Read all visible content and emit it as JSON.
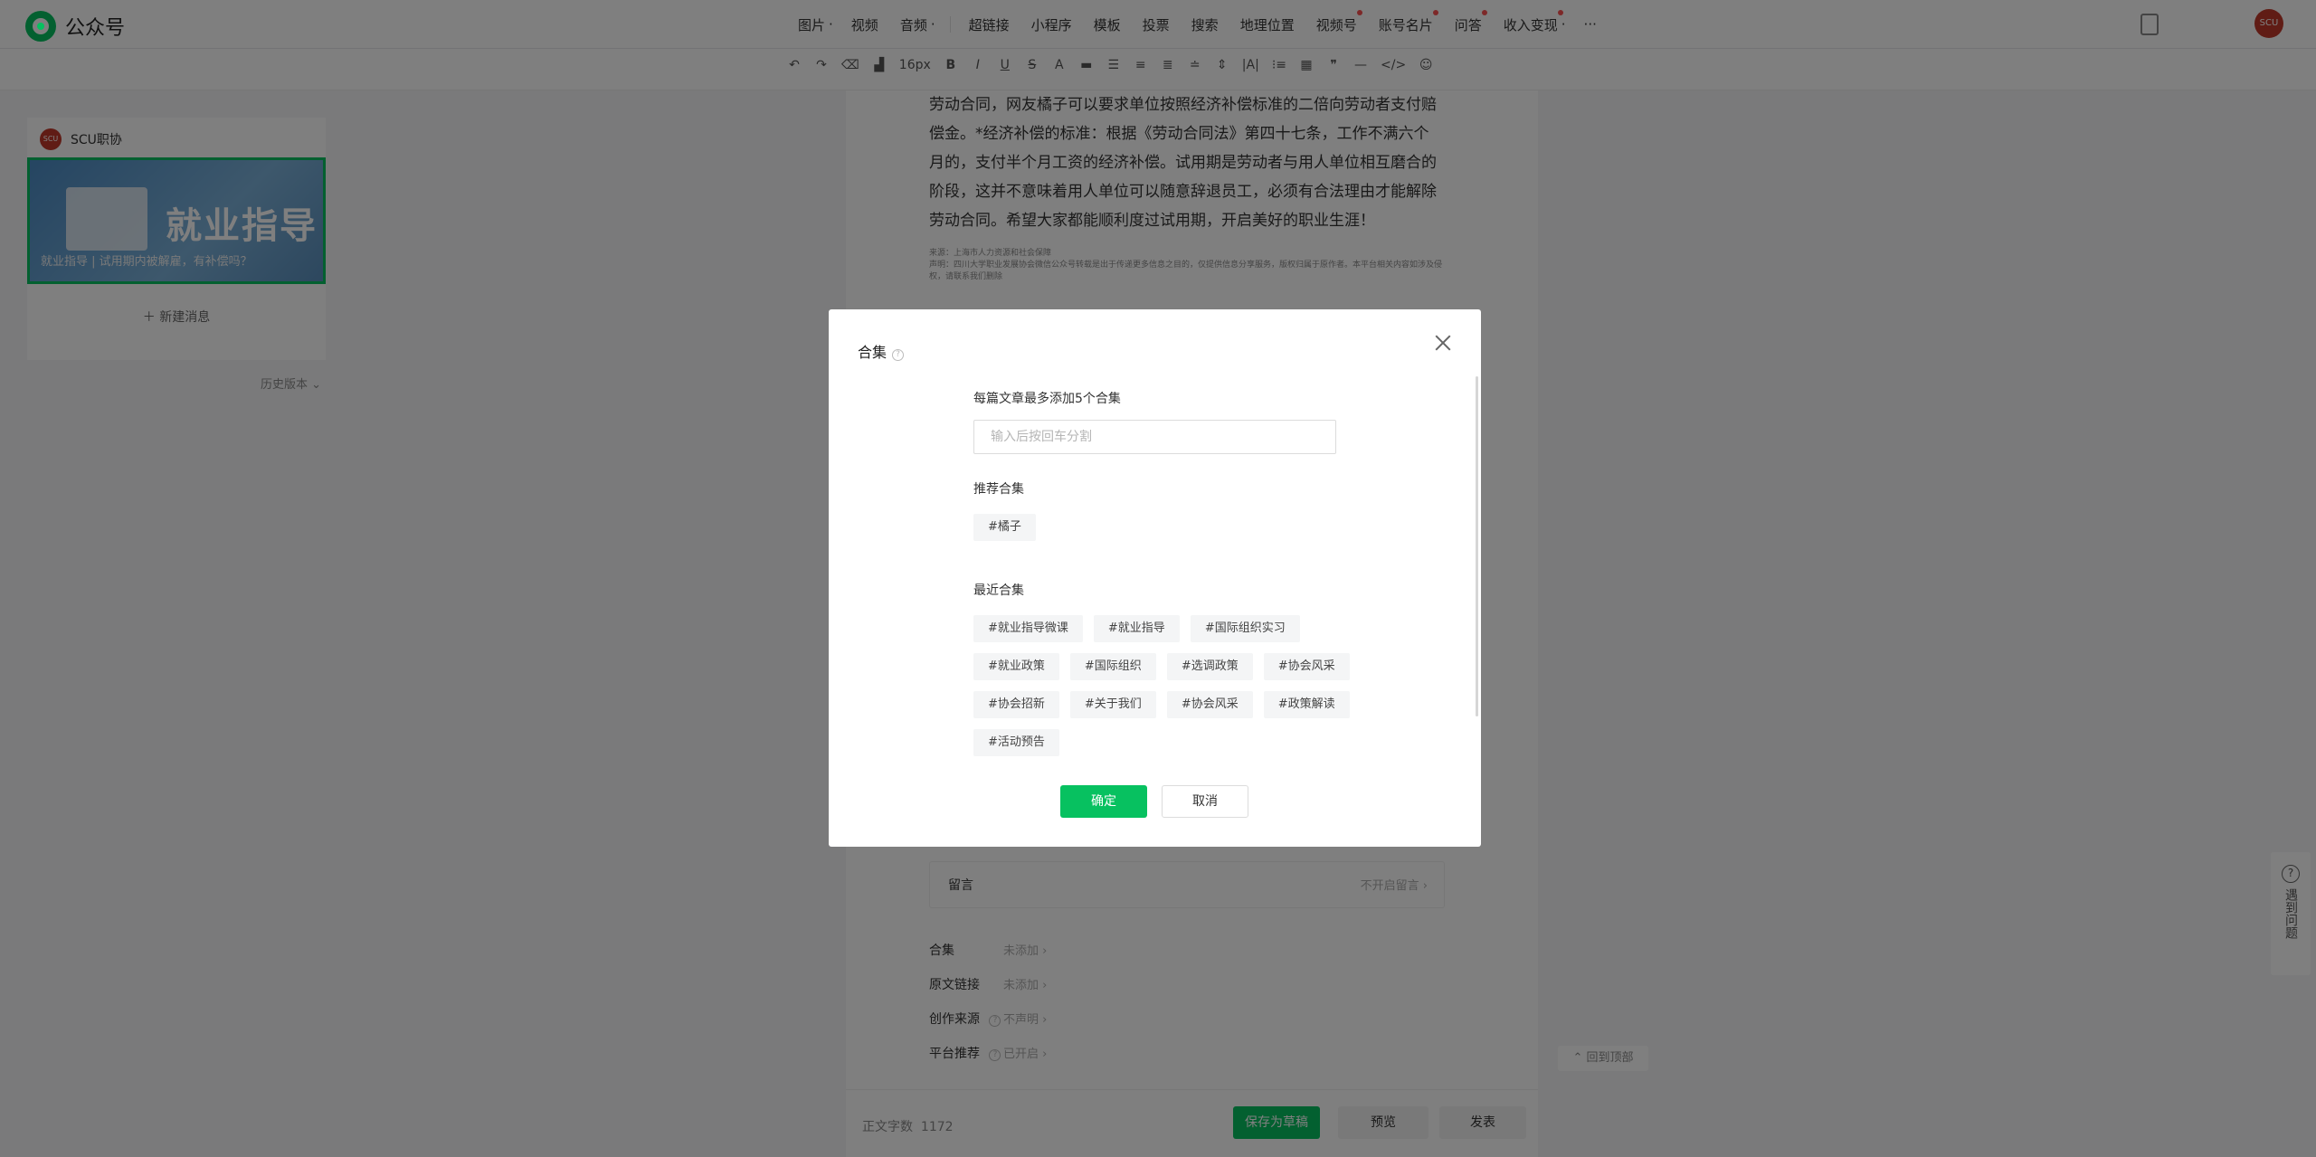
{
  "app": {
    "name": "公众号",
    "account": "SCU职协",
    "avatar_text": "SCU"
  },
  "nav": {
    "items": [
      {
        "label": "图片",
        "dropdown": true
      },
      {
        "label": "视频"
      },
      {
        "label": "音频",
        "dropdown": true
      },
      {
        "label": "超链接"
      },
      {
        "label": "小程序"
      },
      {
        "label": "模板"
      },
      {
        "label": "投票"
      },
      {
        "label": "搜索"
      },
      {
        "label": "地理位置"
      },
      {
        "label": "视频号",
        "dot": true
      },
      {
        "label": "账号名片",
        "dot": true
      },
      {
        "label": "问答",
        "dot": true
      },
      {
        "label": "收入变现",
        "dropdown": true,
        "dot": true
      },
      {
        "label": "···"
      }
    ]
  },
  "toolbar": {
    "font_size": "16px"
  },
  "left": {
    "cover_title": "就业指导",
    "cover_caption": "就业指导 | 试用期内被解雇，有补偿吗？",
    "new_message": "＋ 新建消息",
    "history": "历史版本"
  },
  "editor": {
    "paragraphs": [
      "劳动合同，网友橘子可以要求单位按照经济补偿标准的二倍向劳动者支付赔偿金。*经济补偿的标准：根据《劳动合同法》第四十七条，工作不满六个月的，支付半个月工资的经济补偿。试用期是劳动者与用人单位相互磨合的阶段，这并不意味着用人单位可以随意辞退员工，必须有合法理由才能解除劳动合同。希望大家都能顺利度过试用期，开启美好的职业生涯！"
    ],
    "source": "来源：上海市人力资源和社会保障",
    "statement": "声明：四川大学职业发展协会微信公众号转载是出于传递更多信息之目的，仅提供信息分享服务，版权归属于原作者。本平台相关内容如涉及侵权，请联系我们删除",
    "comment_label": "留言",
    "comment_value": "不开启留言",
    "meta": [
      {
        "label": "合集",
        "value": "未添加"
      },
      {
        "label": "原文链接",
        "value": "未添加"
      },
      {
        "label": "创作来源",
        "value": "不声明"
      },
      {
        "label": "平台推荐",
        "value": "已开启"
      }
    ],
    "wordcount_label": "正文字数",
    "wordcount": "1172",
    "save_label": "保存为草稿",
    "preview_label": "预览",
    "publish_label": "发表"
  },
  "help": {
    "label": "遇到问题"
  },
  "backtop": {
    "label": "回到顶部"
  },
  "modal": {
    "title": "合集",
    "limit_label": "每篇文章最多添加5个合集",
    "input_placeholder": "输入后按回车分割",
    "recommended_label": "推荐合集",
    "recommended": [
      "#橘子"
    ],
    "recent_label": "最近合集",
    "recent": [
      "#就业指导微课",
      "#就业指导",
      "#国际组织实习",
      "#就业政策",
      "#国际组织",
      "#选调政策",
      "#协会风采",
      "#协会招新",
      "#关于我们",
      "#协会风采",
      "#政策解读",
      "#活动预告"
    ],
    "confirm_label": "确定",
    "cancel_label": "取消"
  }
}
